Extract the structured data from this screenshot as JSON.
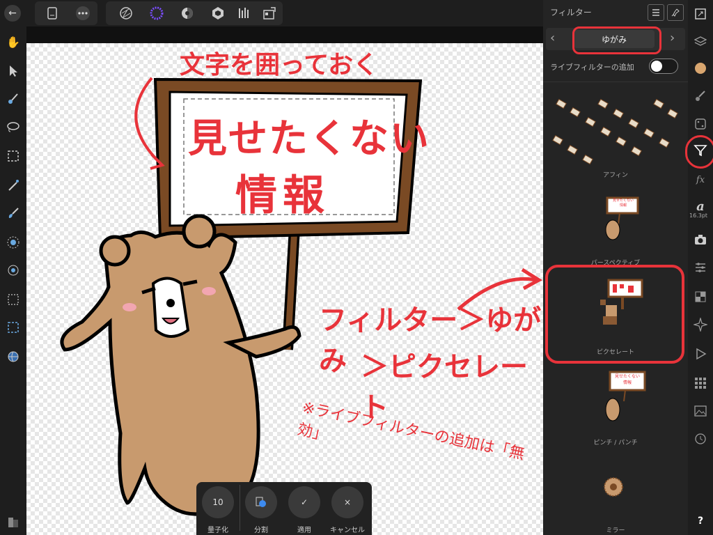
{
  "panel": {
    "title": "フィルター",
    "category": "ゆがみ",
    "live_filter_label": "ライブフィルターの追加",
    "filters": [
      {
        "label": "アフィン"
      },
      {
        "label": "パースペクティブ"
      },
      {
        "label": "ピクセレート"
      },
      {
        "label": "ピンチ / パンチ"
      },
      {
        "label": "ミラー"
      }
    ]
  },
  "canvas": {
    "sign_title": "見せたくない",
    "sign_title2": "情報",
    "annotation_top": "文字を囲っておく",
    "annotation_step1": "フィルター＞ゆがみ",
    "annotation_step2": "＞ピクセレート",
    "annotation_note": "※ライブフィルターの追加は「無効」",
    "mini_sign": "見せたくない\n情報"
  },
  "iconbar": {
    "font_size": "16.3pt",
    "font_glyph": "a",
    "help": "?"
  },
  "dialog": {
    "quantize_value": "10",
    "quantize_label": "量子化",
    "split_label": "分割",
    "apply_label": "適用",
    "cancel_label": "キャンセル",
    "apply_glyph": "✓",
    "cancel_glyph": "×"
  },
  "colors": {
    "accent_red": "#e8333a",
    "accent_purple": "#7b4dff",
    "bear": "#c89a6e",
    "sign_wood": "#7a4a24"
  }
}
